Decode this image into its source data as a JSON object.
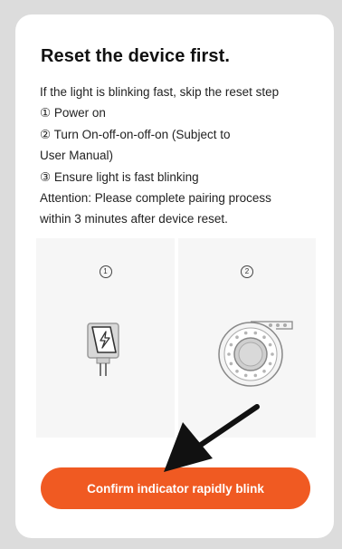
{
  "card": {
    "title": "Reset the device first.",
    "lines": [
      "If the light is blinking fast, skip the reset step",
      "① Power on",
      "② Turn On-off-on-off-on (Subject to",
      "User Manual)",
      "③ Ensure light is fast blinking",
      "Attention: Please complete pairing process",
      "within 3 minutes after device reset."
    ]
  },
  "illustrations": {
    "step1": {
      "number": "1",
      "icon": "power-plug-icon"
    },
    "step2": {
      "number": "2",
      "icon": "fan-device-icon"
    }
  },
  "confirm_button": {
    "label": "Confirm indicator rapidly blink",
    "color": "#f05a22"
  },
  "overlay": {
    "icon": "arrow-pointer-icon",
    "color": "#111111"
  }
}
